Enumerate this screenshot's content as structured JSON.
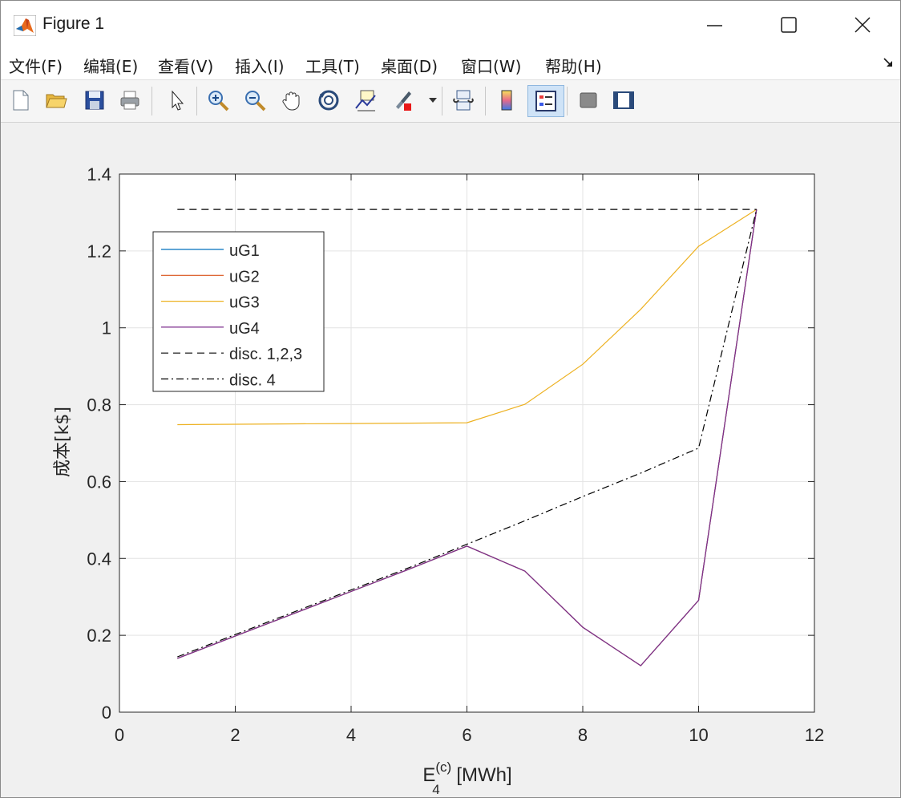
{
  "window": {
    "title": "Figure 1"
  },
  "menu": [
    {
      "label": "文件(F)"
    },
    {
      "label": "编辑(E)"
    },
    {
      "label": "查看(V)"
    },
    {
      "label": "插入(I)"
    },
    {
      "label": "工具(T)"
    },
    {
      "label": "桌面(D)"
    },
    {
      "label": "窗口(W)"
    },
    {
      "label": "帮助(H)"
    }
  ],
  "toolbar": [
    {
      "icon": "new-figure-icon"
    },
    {
      "icon": "open-folder-icon"
    },
    {
      "icon": "save-icon"
    },
    {
      "icon": "print-icon"
    },
    {
      "icon": "pointer-icon"
    },
    {
      "icon": "zoom-in-icon"
    },
    {
      "icon": "zoom-out-icon"
    },
    {
      "icon": "pan-hand-icon"
    },
    {
      "icon": "rotate-3d-icon"
    },
    {
      "icon": "data-cursor-icon"
    },
    {
      "icon": "brush-icon"
    },
    {
      "icon": "link-plot-icon"
    },
    {
      "icon": "colorbar-icon"
    },
    {
      "icon": "legend-icon",
      "active": true
    },
    {
      "icon": "hide-plot-tools-icon"
    },
    {
      "icon": "show-plot-tools-icon"
    }
  ],
  "chart_data": {
    "type": "line",
    "title": "",
    "xlabel": "E_4^(c) [MWh]",
    "xlabel_parts": {
      "base": "E",
      "sub": "4",
      "sup": "(c)",
      "unit": " [MWh]"
    },
    "ylabel": "成本[k$]",
    "xlim": [
      0,
      12
    ],
    "ylim": [
      0,
      1.4
    ],
    "xticks": [
      0,
      2,
      4,
      6,
      8,
      10,
      12
    ],
    "yticks": [
      0,
      0.2,
      0.4,
      0.6,
      0.8,
      1,
      1.2,
      1.4
    ],
    "xtick_labels": [
      "0",
      "2",
      "4",
      "6",
      "8",
      "10",
      "12"
    ],
    "ytick_labels": [
      "0",
      "0.2",
      "0.4",
      "0.6",
      "0.8",
      "1",
      "1.2",
      "1.4"
    ],
    "grid": true,
    "legend_position": "top-left",
    "series": [
      {
        "name": "uG1",
        "color": "#0072BD",
        "style": "solid",
        "x": [
          1,
          2,
          3,
          4,
          5,
          6,
          7,
          8,
          9,
          10,
          11
        ],
        "y": [
          0.14,
          0.198,
          0.256,
          0.314,
          0.372,
          0.432,
          0.367,
          0.221,
          0.121,
          0.291,
          1.308
        ]
      },
      {
        "name": "uG2",
        "color": "#D95319",
        "style": "solid",
        "x": [
          1,
          2,
          3,
          4,
          5,
          6,
          7,
          8,
          9,
          10,
          11
        ],
        "y": [
          0.14,
          0.198,
          0.256,
          0.314,
          0.372,
          0.432,
          0.367,
          0.221,
          0.121,
          0.291,
          1.308
        ]
      },
      {
        "name": "uG3",
        "color": "#EDB120",
        "style": "solid",
        "x": [
          1,
          2,
          3,
          4,
          5,
          6,
          7,
          8,
          9,
          10,
          11
        ],
        "y": [
          0.748,
          0.749,
          0.75,
          0.751,
          0.752,
          0.753,
          0.801,
          0.905,
          1.048,
          1.212,
          1.308
        ]
      },
      {
        "name": "uG4",
        "color": "#7E2F8E",
        "style": "solid",
        "x": [
          1,
          2,
          3,
          4,
          5,
          6,
          7,
          8,
          9,
          10,
          11
        ],
        "y": [
          0.14,
          0.198,
          0.256,
          0.314,
          0.372,
          0.432,
          0.367,
          0.221,
          0.121,
          0.291,
          1.308
        ]
      },
      {
        "name": "disc. 1,2,3",
        "color": "#000000",
        "style": "dashed",
        "x": [
          1,
          11
        ],
        "y": [
          1.308,
          1.308
        ]
      },
      {
        "name": "disc. 4",
        "color": "#000000",
        "style": "dashdot",
        "x": [
          1,
          2,
          3,
          4,
          5,
          6,
          7,
          8,
          9,
          10,
          11
        ],
        "y": [
          0.144,
          0.202,
          0.26,
          0.318,
          0.376,
          0.437,
          0.498,
          0.561,
          0.622,
          0.687,
          1.308
        ]
      }
    ]
  }
}
